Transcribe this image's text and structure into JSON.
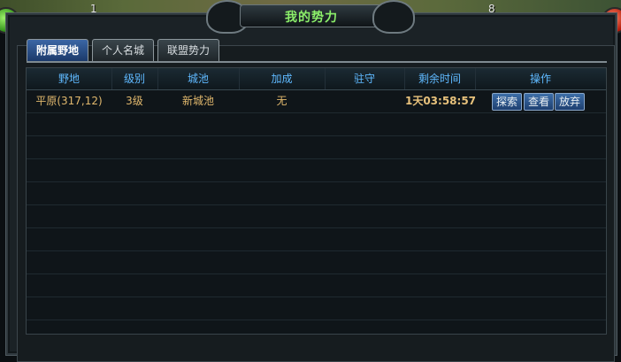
{
  "hud": {
    "left_num": "1",
    "right_num": "8"
  },
  "window": {
    "title": "我的势力"
  },
  "tabs": [
    {
      "label": "附属野地",
      "active": true
    },
    {
      "label": "个人名城",
      "active": false
    },
    {
      "label": "联盟势力",
      "active": false
    }
  ],
  "table": {
    "headers": [
      "野地",
      "级别",
      "城池",
      "加成",
      "驻守",
      "剩余时间",
      "操作"
    ],
    "rows": [
      {
        "field": "平原(317,12)",
        "level": "3级",
        "city": "新城池",
        "bonus": "无",
        "garrison": "",
        "time": "1天03:58:57",
        "actions": [
          "探索",
          "查看",
          "放弃"
        ]
      }
    ]
  },
  "colors": {
    "title": "#8cf06a",
    "header_text": "#5fb9ff",
    "row_text": "#e1b86d",
    "tab_active_bg": "#2f5a97"
  },
  "icons": [
    "left-orb-icon",
    "right-orb-icon",
    "title-ornament-icon"
  ]
}
